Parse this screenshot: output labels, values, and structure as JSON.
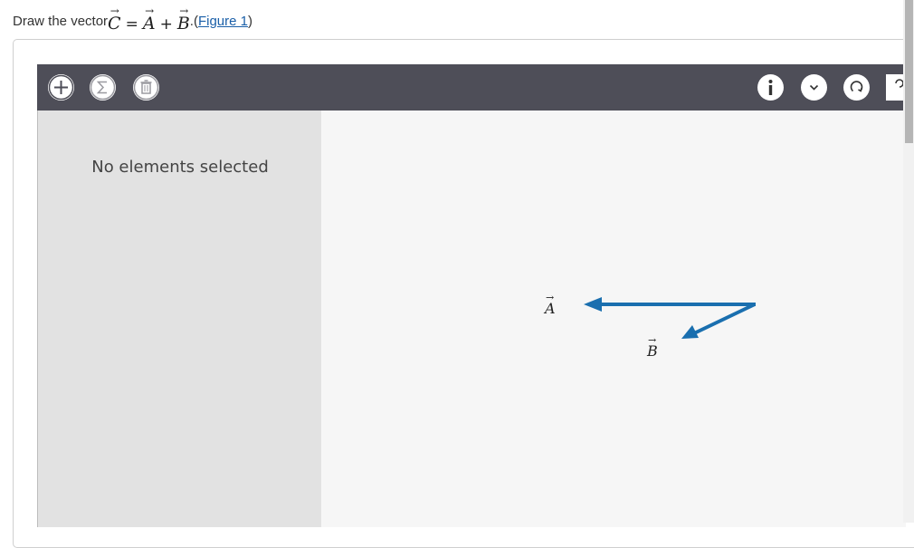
{
  "question": {
    "prefix": "Draw the vector ",
    "vec_c": "C",
    "eq": "=",
    "vec_a": "A",
    "plus": "+",
    "vec_b": "B",
    "dot": ".",
    "paren_open": "(",
    "link": "Figure 1",
    "paren_close": ")"
  },
  "toolbar": {
    "add_icon": "plus-icon",
    "sum_icon": "sigma-icon",
    "delete_icon": "trash-icon",
    "info_icon": "info-icon",
    "dropdown_icon": "chevron-down-icon",
    "reset_icon": "reset-icon",
    "help_icon": "help-icon"
  },
  "sidebar": {
    "empty_text": "No elements selected"
  },
  "canvas": {
    "label_a": "A",
    "label_b": "B",
    "vector_color": "#1a6faf"
  },
  "colors": {
    "toolbar_bg": "#4e4e58",
    "sidebar_bg": "#e2e2e2",
    "canvas_bg": "#f6f6f6",
    "link": "#1a5fa8"
  }
}
